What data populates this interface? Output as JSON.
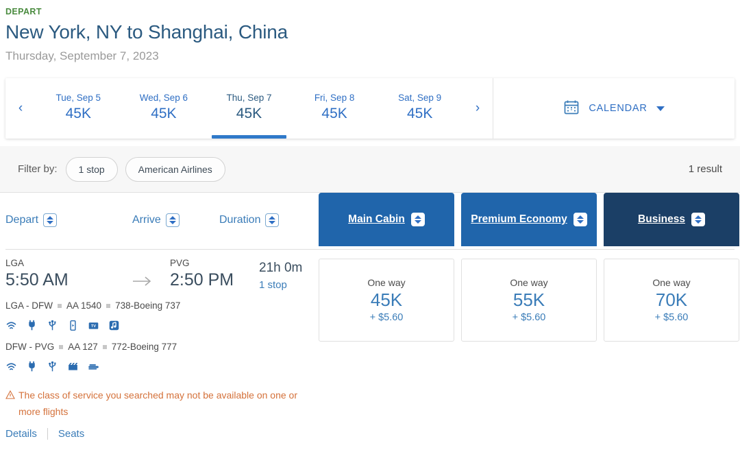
{
  "header": {
    "depart_label": "DEPART",
    "route_title": "New York, NY to Shanghai, China",
    "route_date": "Thursday, September 7, 2023"
  },
  "datestrip": {
    "prev_arrow": "‹",
    "next_arrow": "›",
    "days": [
      {
        "name": "Tue, Sep 5",
        "price": "45K",
        "selected": false
      },
      {
        "name": "Wed, Sep 6",
        "price": "45K",
        "selected": false
      },
      {
        "name": "Thu, Sep 7",
        "price": "45K",
        "selected": true
      },
      {
        "name": "Fri, Sep 8",
        "price": "45K",
        "selected": false
      },
      {
        "name": "Sat, Sep 9",
        "price": "45K",
        "selected": false
      }
    ],
    "calendar_label": "CALENDAR",
    "calendar_icon": "calendar-icon",
    "caret_icon": "chevron-down-icon"
  },
  "filterbar": {
    "label": "Filter by:",
    "chips": [
      "1 stop",
      "American Airlines"
    ],
    "result_count": "1 result"
  },
  "table": {
    "sort_columns": [
      {
        "label": "Depart",
        "icon": "sort-icon"
      },
      {
        "label": "Arrive",
        "icon": "sort-icon"
      },
      {
        "label": "Duration",
        "icon": "sort-icon"
      }
    ],
    "cabins": [
      {
        "label": "Main Cabin",
        "style": "mid"
      },
      {
        "label": "Premium Economy",
        "style": "mid"
      },
      {
        "label": "Business",
        "style": "dark"
      }
    ]
  },
  "flight": {
    "depart_airport": "LGA",
    "depart_time": "5:50 AM",
    "arrive_airport": "PVG",
    "arrive_time": "2:50 PM",
    "duration": "21h 0m",
    "stops": "1 stop",
    "arrow_icon": "arrow-right-icon",
    "segments": [
      {
        "route": "LGA - DFW",
        "flight_no": "AA 1540",
        "aircraft": "738-Boeing 737",
        "amenities": [
          "wifi-icon",
          "power-icon",
          "usb-icon",
          "device-icon",
          "tv-icon",
          "music-icon"
        ]
      },
      {
        "route": "DFW - PVG",
        "flight_no": "AA 127",
        "aircraft": "772-Boeing 777",
        "amenities": [
          "wifi-icon",
          "power-icon",
          "usb-icon",
          "movie-icon",
          "lieflat-seat-icon"
        ]
      }
    ],
    "warning_icon": "warning-triangle-icon",
    "warning_text": "The class of service you searched may not be available on one or more flights",
    "links": [
      "Details",
      "Seats"
    ]
  },
  "prices": [
    {
      "label": "One way",
      "miles": "45K",
      "tax": "+ $5.60"
    },
    {
      "label": "One way",
      "miles": "55K",
      "tax": "+ $5.60"
    },
    {
      "label": "One way",
      "miles": "70K",
      "tax": "+ $5.60"
    }
  ],
  "colors": {
    "depart_green": "#4a8b3f",
    "title_blue": "#2b5a80",
    "link_blue": "#3a7cb8",
    "cabin_blue": "#2065ab",
    "cabin_navy": "#1b3f66",
    "warning_orange": "#d4713a"
  }
}
